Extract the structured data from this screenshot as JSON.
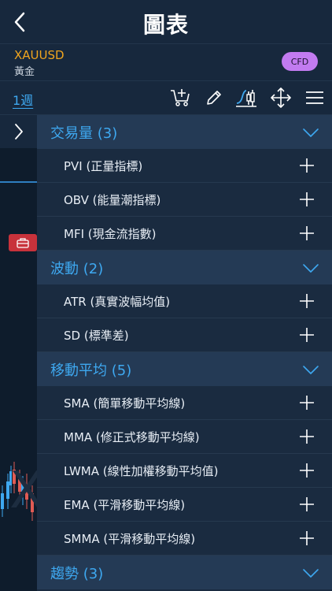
{
  "header": {
    "title": "圖表"
  },
  "symbol": {
    "code": "XAUUSD",
    "name": "黃金",
    "badge": "CFD"
  },
  "toolbar": {
    "period": "1週"
  },
  "chart": {
    "watermark": "X"
  },
  "groups": [
    {
      "title": "交易量 (3)",
      "items": [
        "PVI (正量指標)",
        "OBV (能量潮指標)",
        "MFI (現金流指數)"
      ]
    },
    {
      "title": "波動 (2)",
      "items": [
        "ATR (真實波幅均值)",
        "SD (標準差)"
      ]
    },
    {
      "title": "移動平均 (5)",
      "items": [
        "SMA (簡單移動平均線)",
        "MMA (修正式移動平均線)",
        "LWMA (線性加權移動平均值)",
        "EMA (平滑移動平均線)",
        "SMMA (平滑移動平均線)"
      ]
    },
    {
      "title": "趨勢 (3)",
      "items": []
    }
  ],
  "colors": {
    "accent": "#3ea8f0",
    "symbol": "#f0a51e",
    "badge": "#c27bf0",
    "alert": "#c8323b"
  },
  "icons": [
    "back-arrow-icon",
    "add-indicator-icon",
    "pencil-icon",
    "indicator-chart-icon",
    "move-arrows-icon",
    "menu-icon",
    "chevron-right-icon",
    "briefcase-icon",
    "chevron-down-icon",
    "plus-icon"
  ]
}
